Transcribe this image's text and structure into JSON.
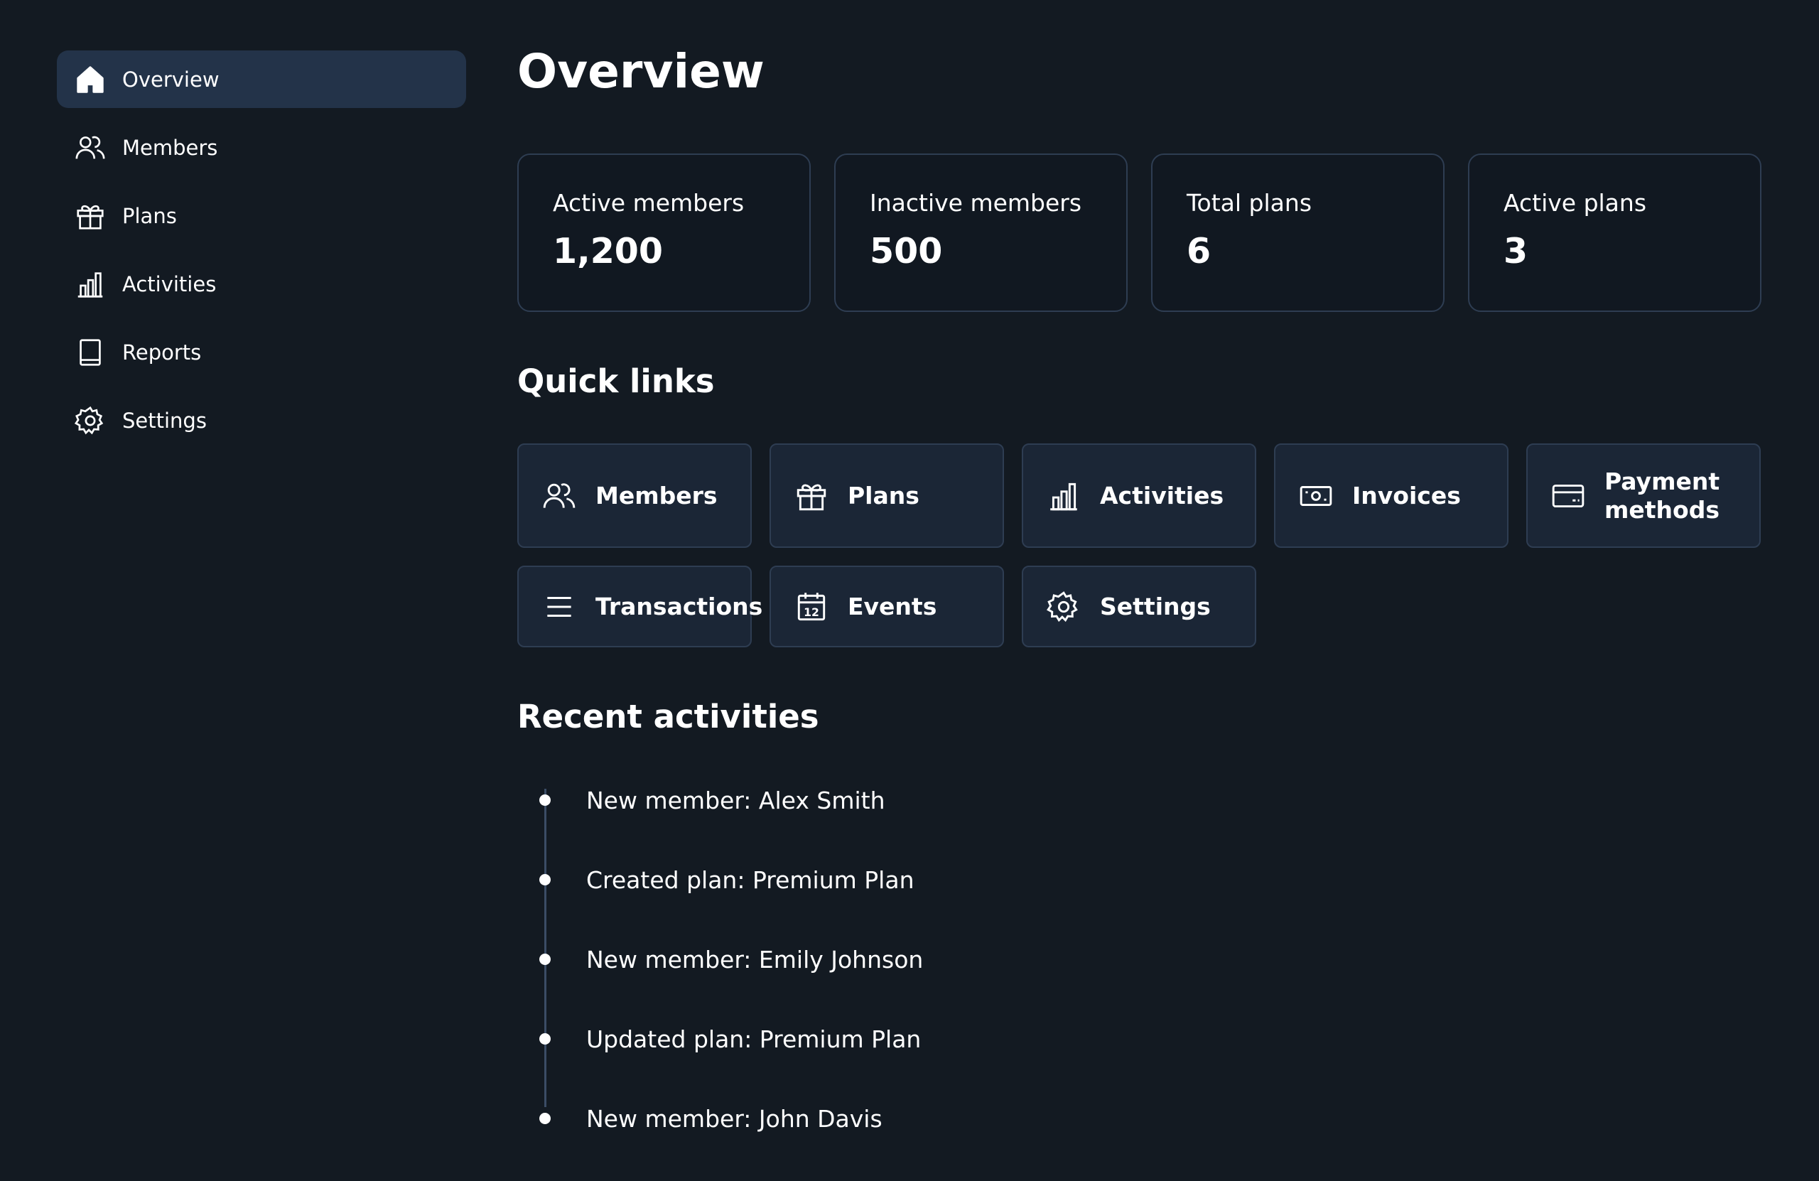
{
  "sidebar": {
    "items": [
      {
        "label": "Overview",
        "icon": "home-icon",
        "active": true
      },
      {
        "label": "Members",
        "icon": "users-icon"
      },
      {
        "label": "Plans",
        "icon": "gift-icon"
      },
      {
        "label": "Activities",
        "icon": "bar-chart-icon"
      },
      {
        "label": "Reports",
        "icon": "book-icon"
      },
      {
        "label": "Settings",
        "icon": "gear-icon"
      }
    ]
  },
  "main": {
    "title": "Overview",
    "stats": [
      {
        "label": "Active members",
        "value": "1,200"
      },
      {
        "label": "Inactive members",
        "value": "500"
      },
      {
        "label": "Total plans",
        "value": "6"
      },
      {
        "label": "Active plans",
        "value": "3"
      }
    ],
    "quick_links_title": "Quick links",
    "quick_links": [
      {
        "label": "Members",
        "icon": "users-icon"
      },
      {
        "label": "Plans",
        "icon": "gift-icon"
      },
      {
        "label": "Activities",
        "icon": "bar-chart-icon"
      },
      {
        "label": "Invoices",
        "icon": "banknote-icon"
      },
      {
        "label": "Payment methods",
        "icon": "credit-card-icon"
      },
      {
        "label": "Transactions",
        "icon": "list-icon"
      },
      {
        "label": "Events",
        "icon": "calendar-icon"
      },
      {
        "label": "Settings",
        "icon": "gear-icon"
      }
    ],
    "recent_title": "Recent activities",
    "recent": [
      "New member: Alex Smith",
      "Created plan: Premium Plan",
      "New member: Emily Johnson",
      "Updated plan: Premium Plan",
      "New member: John Davis"
    ]
  },
  "colors": {
    "background": "#131a22",
    "active_nav": "#233349",
    "card_border": "#2e3d52",
    "link_card_bg": "#1b2636"
  }
}
